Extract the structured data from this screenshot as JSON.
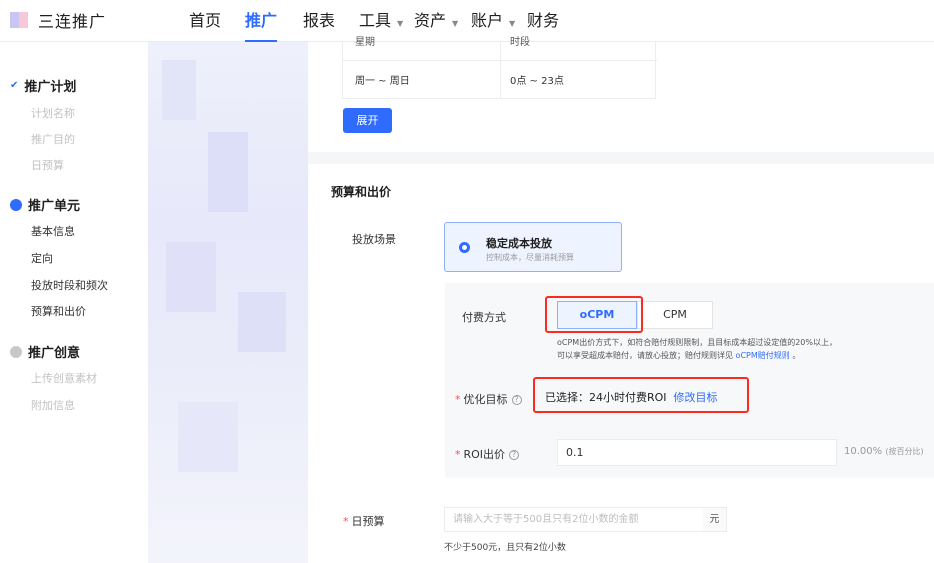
{
  "header": {
    "logo_text": "三连推广",
    "nav": [
      {
        "label": "首页"
      },
      {
        "label": "推广"
      },
      {
        "label": "报表"
      },
      {
        "label": "工具"
      },
      {
        "label": "资产"
      },
      {
        "label": "账户"
      },
      {
        "label": "财务"
      }
    ]
  },
  "sidebar": {
    "groups": [
      {
        "label": "推广计划",
        "items": [
          "计划名称",
          "推广目的",
          "日预算"
        ]
      },
      {
        "label": "推广单元",
        "items": [
          "基本信息",
          "定向",
          "投放时段和频次",
          "预算和出价"
        ]
      },
      {
        "label": "推广创意",
        "items": [
          "上传创意素材",
          "附加信息"
        ]
      }
    ]
  },
  "schedule_table": {
    "headers": [
      "星期",
      "时段"
    ],
    "row": [
      "周一 ~ 周日",
      "0点 ~ 23点"
    ]
  },
  "expand_button": "展开",
  "budget_section": {
    "title": "预算和出价",
    "scene_label": "投放场景",
    "scene_title": "稳定成本投放",
    "scene_desc": "控制成本，尽量消耗预算",
    "billing_label": "付费方式",
    "billing_options": [
      "oCPM",
      "CPM"
    ],
    "ocpm_note_line1": "oCPM出价方式下，如符合赔付规则限制，且目标成本超过设定值的20%以上，",
    "ocpm_note_line2": "可以享受超成本赔付，请放心投放；赔付规则详见",
    "ocpm_note_link": "oCPM赔付规则",
    "ocpm_note_end": "。",
    "goal_label": "优化目标",
    "goal_selected": "已选择：24小时付费ROI",
    "goal_modify": "修改目标",
    "roi_label": "ROI出价",
    "roi_value": "0.1",
    "roi_suffix": "10.00%",
    "roi_suffix_note": "(按百分比)",
    "daily_label": "日预算",
    "daily_placeholder": "请输入大于等于500且只有2位小数的金额",
    "daily_unit": "元",
    "daily_hint": "不少于500元，且只有2位小数",
    "help_glyph": "?"
  }
}
